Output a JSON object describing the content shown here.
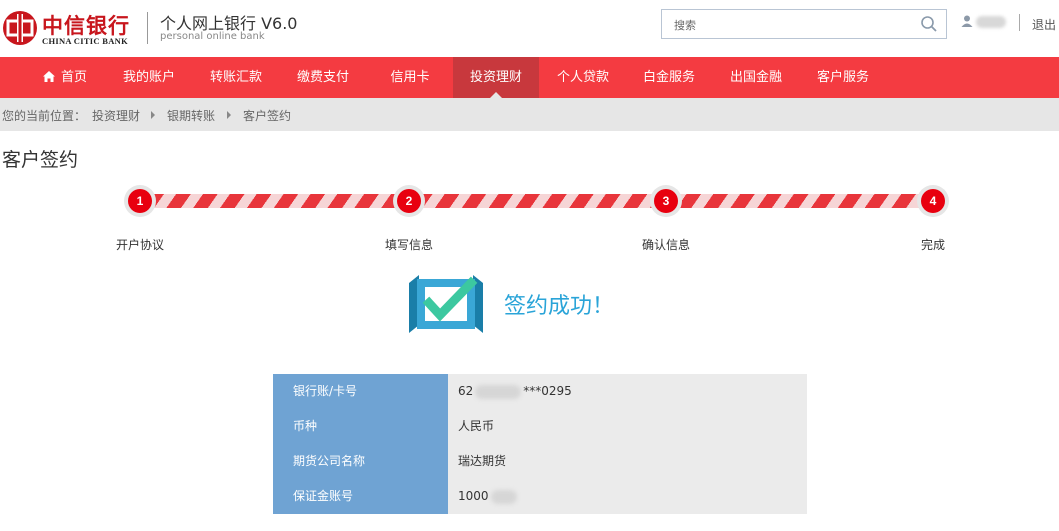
{
  "header": {
    "logo_cn": "中信银行",
    "logo_en": "CHINA CITIC BANK",
    "site_title": "个人网上银行 V6.0",
    "site_subtitle": "personal online bank",
    "search_placeholder": "搜索",
    "logout_label": "退出"
  },
  "nav": {
    "items": [
      {
        "label": "首页",
        "icon": "home-icon"
      },
      {
        "label": "我的账户"
      },
      {
        "label": "转账汇款"
      },
      {
        "label": "缴费支付"
      },
      {
        "label": "信用卡"
      },
      {
        "label": "投资理财",
        "active": true
      },
      {
        "label": "个人贷款"
      },
      {
        "label": "白金服务"
      },
      {
        "label": "出国金融"
      },
      {
        "label": "客户服务"
      }
    ]
  },
  "breadcrumb": {
    "prefix": "您的当前位置：",
    "items": [
      "投资理财",
      "银期转账",
      "客户签约"
    ]
  },
  "page_title": "客户签约",
  "steps": [
    {
      "number": "1",
      "label": "开户协议"
    },
    {
      "number": "2",
      "label": "填写信息"
    },
    {
      "number": "3",
      "label": "确认信息"
    },
    {
      "number": "4",
      "label": "完成"
    }
  ],
  "success_message": "签约成功！",
  "info_table": [
    {
      "label": "银行账/卡号",
      "value_prefix": "62",
      "value_suffix": "***0295"
    },
    {
      "label": "币种",
      "value": "人民币"
    },
    {
      "label": "期货公司名称",
      "value": "瑞达期货"
    },
    {
      "label": "保证金账号",
      "value_prefix": "1000"
    }
  ],
  "colors": {
    "brand_red": "#f43b41",
    "nav_active": "#c8383d",
    "step_red": "#e8000f",
    "success_blue": "#2aa4d8",
    "table_label_bg": "#6fa3d3",
    "table_value_bg": "#ebebeb"
  }
}
